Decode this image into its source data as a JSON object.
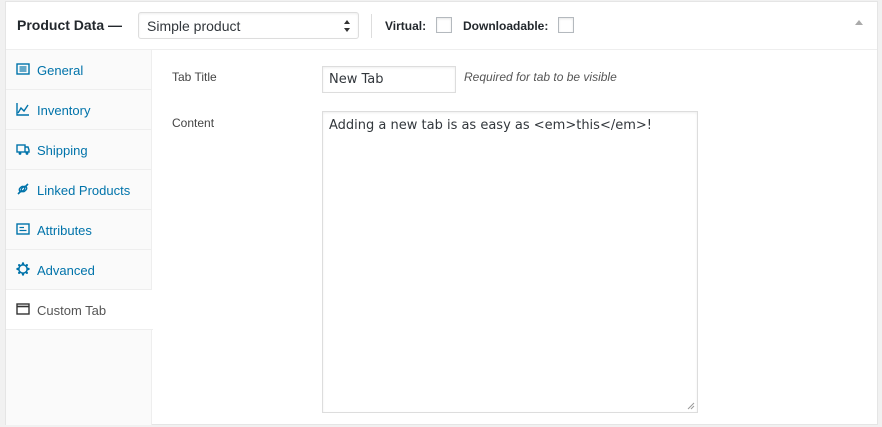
{
  "header": {
    "title": "Product Data —",
    "product_type": "Simple product",
    "virtual_label": "Virtual:",
    "virtual_checked": false,
    "downloadable_label": "Downloadable:",
    "downloadable_checked": false
  },
  "tabs": [
    {
      "label": "General",
      "icon": "general-icon",
      "active": false
    },
    {
      "label": "Inventory",
      "icon": "inventory-icon",
      "active": false
    },
    {
      "label": "Shipping",
      "icon": "shipping-icon",
      "active": false
    },
    {
      "label": "Linked Products",
      "icon": "linked-products-icon",
      "active": false
    },
    {
      "label": "Attributes",
      "icon": "attributes-icon",
      "active": false
    },
    {
      "label": "Advanced",
      "icon": "advanced-icon",
      "active": false
    },
    {
      "label": "Custom Tab",
      "icon": "custom-tab-icon",
      "active": true
    }
  ],
  "fields": {
    "tab_title_label": "Tab Title",
    "tab_title_value": "New Tab",
    "tab_title_description": "Required for tab to be visible",
    "content_label": "Content",
    "content_value": "Adding a new tab is as easy as <em>this</em>!"
  },
  "colors": {
    "link": "#0073aa",
    "active_label": "#555555",
    "border": "#eeeeee"
  }
}
